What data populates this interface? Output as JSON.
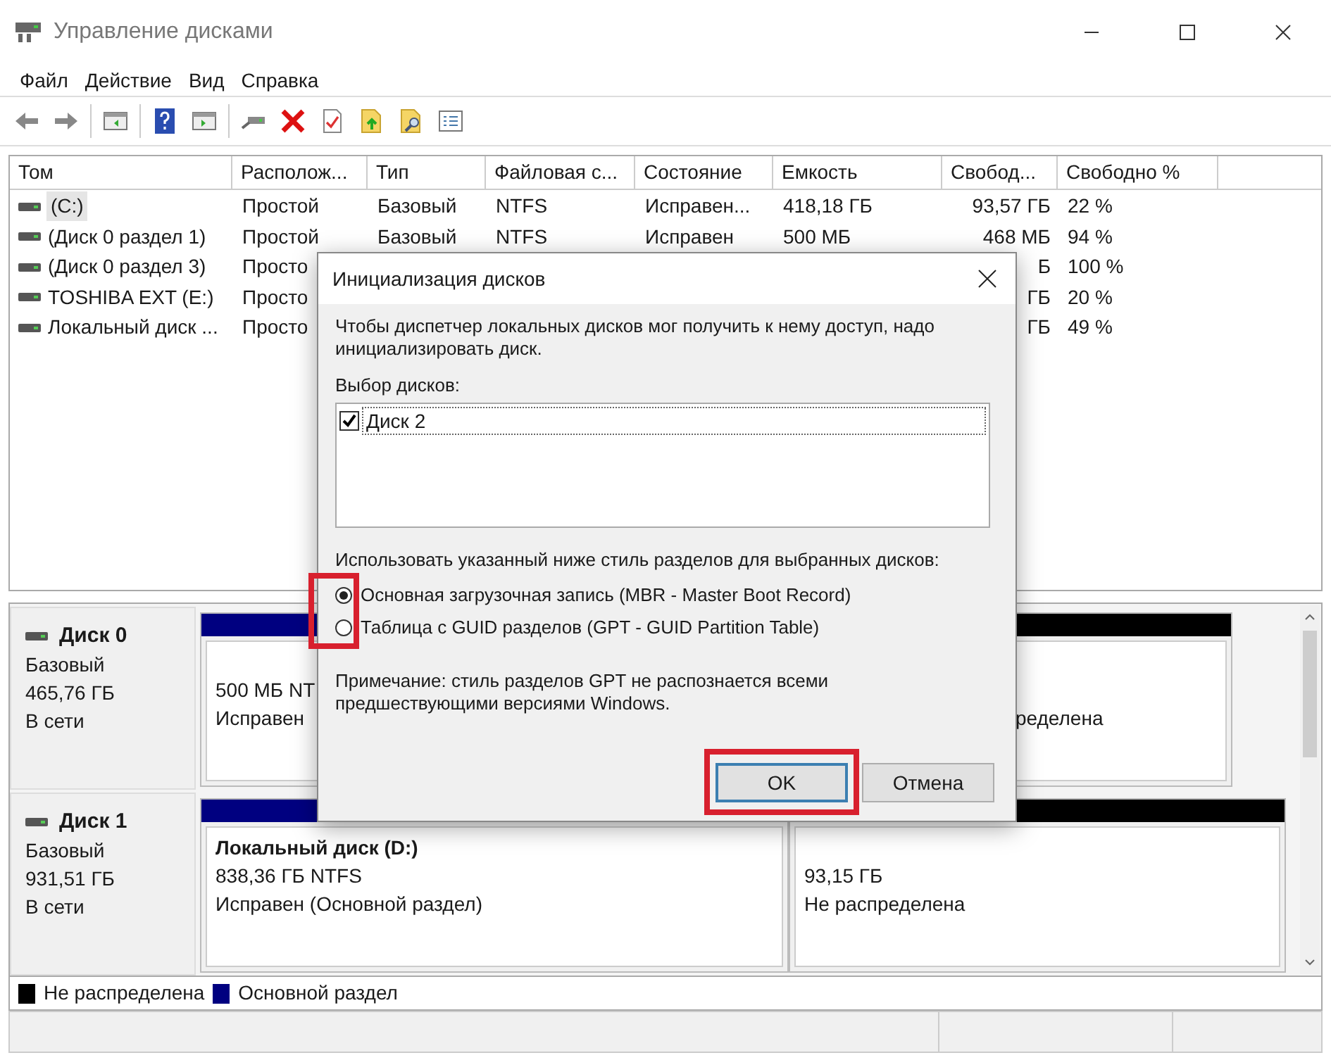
{
  "window": {
    "title": "Управление дисками"
  },
  "menu": [
    "Файл",
    "Действие",
    "Вид",
    "Справка"
  ],
  "table": {
    "columns": [
      "Том",
      "Располож...",
      "Тип",
      "Файловая с...",
      "Состояние",
      "Емкость",
      "Свобод...",
      "Свободно %"
    ],
    "rows": [
      {
        "selected": true,
        "volume": "(C:)",
        "layout": "Простой",
        "type": "Базовый",
        "fs": "NTFS",
        "status": "Исправен...",
        "capacity": "418,18 ГБ",
        "free": "93,57 ГБ",
        "free_pct": "22 %"
      },
      {
        "selected": false,
        "volume": "(Диск 0 раздел 1)",
        "layout": "Простой",
        "type": "Базовый",
        "fs": "NTFS",
        "status": "Исправен",
        "capacity": "500 МБ",
        "free": "468 МБ",
        "free_pct": "94 %"
      },
      {
        "selected": false,
        "volume": "(Диск 0 раздел 3)",
        "layout": "Просто",
        "free": "Б",
        "free_pct": "100 %"
      },
      {
        "selected": false,
        "volume": "TOSHIBA EXT (E:)",
        "layout": "Просто",
        "free": "ГБ",
        "free_pct": "20 %"
      },
      {
        "selected": false,
        "volume": "Локальный диск ...",
        "layout": "Просто",
        "free": "ГБ",
        "free_pct": "49 %"
      }
    ]
  },
  "disks": [
    {
      "name": "Диск 0",
      "type": "Базовый",
      "size": "465,76 ГБ",
      "state": "В сети",
      "partitions": [
        {
          "color": "#000080",
          "size": "500 МБ NT",
          "status": "Исправен"
        },
        {
          "color": "#000000",
          "status": "ределена"
        }
      ]
    },
    {
      "name": "Диск 1",
      "type": "Базовый",
      "size": "931,51 ГБ",
      "state": "В сети",
      "partitions": [
        {
          "color": "#000080",
          "label": "Локальный диск  (D:)",
          "size": "838,36 ГБ NTFS",
          "status": "Исправен (Основной раздел)"
        },
        {
          "color": "#000000",
          "size": "93,15 ГБ",
          "status": "Не распределена"
        }
      ]
    }
  ],
  "legend": [
    {
      "color": "#000000",
      "label": "Не распределена"
    },
    {
      "color": "#000080",
      "label": "Основной раздел"
    }
  ],
  "dialog": {
    "title": "Инициализация дисков",
    "intro": "Чтобы диспетчер локальных дисков мог получить к нему доступ, надо инициализировать диск.",
    "list_label": "Выбор дисков:",
    "disks": [
      {
        "label": "Диск 2",
        "checked": true
      }
    ],
    "style_label": "Использовать указанный ниже стиль разделов для выбранных дисков:",
    "styles": [
      {
        "label": "Основная загрузочная запись (MBR - Master Boot Record)",
        "selected": true
      },
      {
        "label": "Таблица с GUID разделов (GPT - GUID Partition Table)",
        "selected": false
      }
    ],
    "note": "Примечание: стиль разделов GPT не распознается всеми предшествующими версиями Windows.",
    "ok": "OK",
    "cancel": "Отмена"
  }
}
